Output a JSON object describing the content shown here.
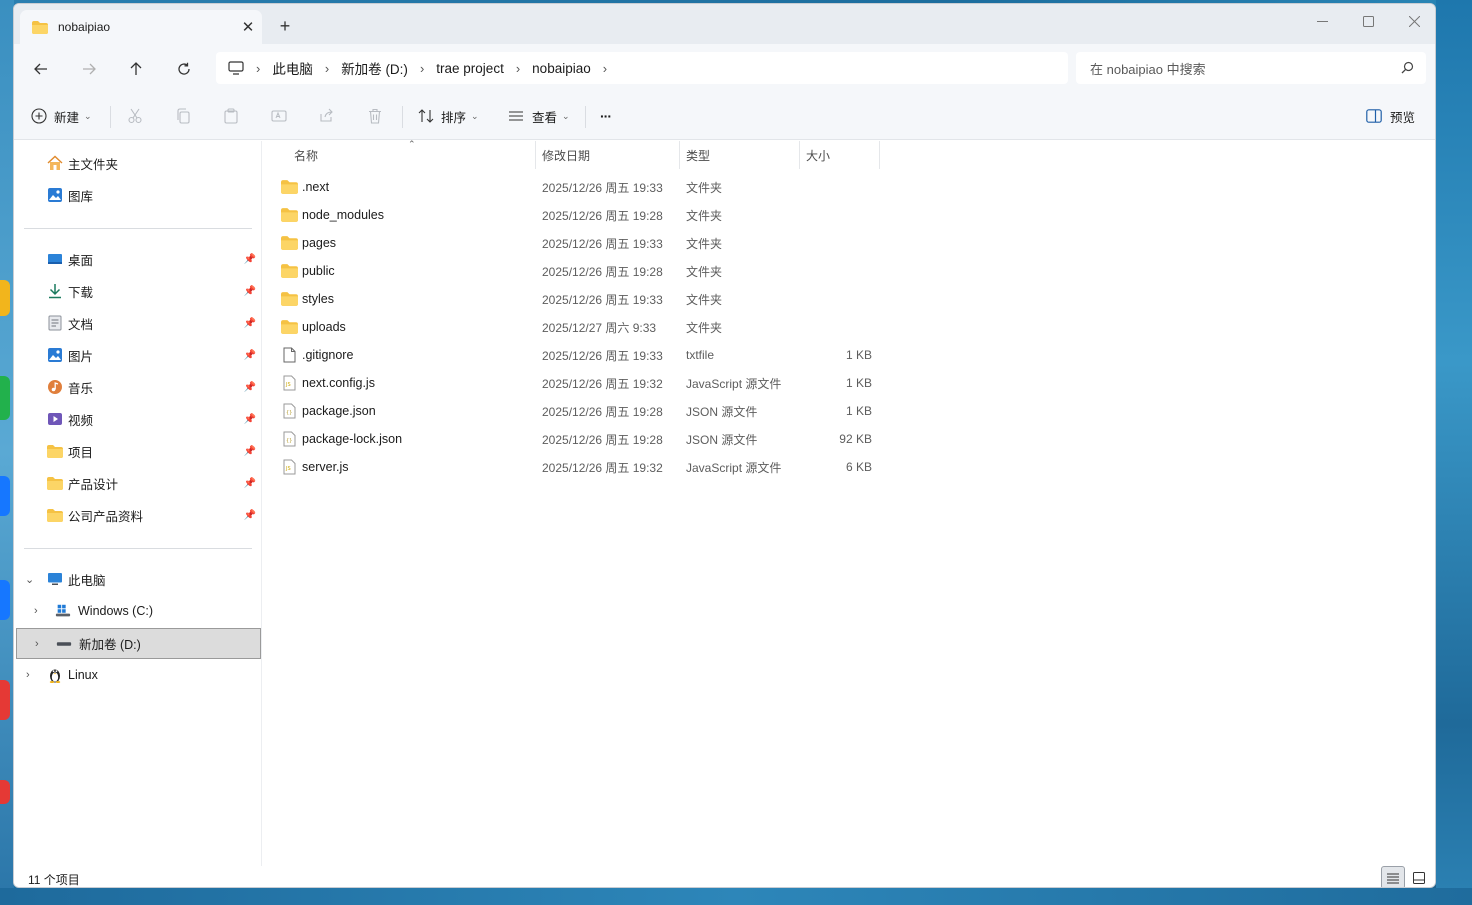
{
  "window": {
    "tab_title": "nobaipiao",
    "new_tab": "+",
    "tab_close": "✕"
  },
  "address": {
    "crumbs": [
      "此电脑",
      "新加卷 (D:)",
      "trae project",
      "nobaipiao"
    ],
    "search_placeholder": "在 nobaipiao 中搜索"
  },
  "toolbar": {
    "new_label": "新建",
    "sort_label": "排序",
    "view_label": "查看",
    "more_label": "···",
    "preview_label": "预览"
  },
  "sidebar": {
    "quick": [
      {
        "label": "主文件夹",
        "icon": "home-icon"
      },
      {
        "label": "图库",
        "icon": "gallery-icon"
      }
    ],
    "pinned": [
      {
        "label": "桌面",
        "icon": "desktop-icon"
      },
      {
        "label": "下载",
        "icon": "download-icon"
      },
      {
        "label": "文档",
        "icon": "document-icon"
      },
      {
        "label": "图片",
        "icon": "pictures-icon"
      },
      {
        "label": "音乐",
        "icon": "music-icon"
      },
      {
        "label": "视频",
        "icon": "video-icon"
      },
      {
        "label": "项目",
        "icon": "folder-icon"
      },
      {
        "label": "产品设计",
        "icon": "folder-icon"
      },
      {
        "label": "公司产品资料",
        "icon": "folder-icon"
      }
    ],
    "pc": {
      "label": "此电脑"
    },
    "drives": [
      {
        "label": "Windows (C:)"
      },
      {
        "label": "新加卷 (D:)"
      }
    ],
    "linux": {
      "label": "Linux"
    }
  },
  "columns": {
    "name": "名称",
    "date": "修改日期",
    "type": "类型",
    "size": "大小"
  },
  "files": [
    {
      "name": ".next",
      "date": "2025/12/26 周五 19:33",
      "type": "文件夹",
      "size": "",
      "kind": "folder"
    },
    {
      "name": "node_modules",
      "date": "2025/12/26 周五 19:28",
      "type": "文件夹",
      "size": "",
      "kind": "folder"
    },
    {
      "name": "pages",
      "date": "2025/12/26 周五 19:33",
      "type": "文件夹",
      "size": "",
      "kind": "folder"
    },
    {
      "name": "public",
      "date": "2025/12/26 周五 19:28",
      "type": "文件夹",
      "size": "",
      "kind": "folder"
    },
    {
      "name": "styles",
      "date": "2025/12/26 周五 19:33",
      "type": "文件夹",
      "size": "",
      "kind": "folder"
    },
    {
      "name": "uploads",
      "date": "2025/12/27 周六 9:33",
      "type": "文件夹",
      "size": "",
      "kind": "folder"
    },
    {
      "name": ".gitignore",
      "date": "2025/12/26 周五 19:33",
      "type": "txtfile",
      "size": "1 KB",
      "kind": "txt"
    },
    {
      "name": "next.config.js",
      "date": "2025/12/26 周五 19:32",
      "type": "JavaScript 源文件",
      "size": "1 KB",
      "kind": "js"
    },
    {
      "name": "package.json",
      "date": "2025/12/26 周五 19:28",
      "type": "JSON 源文件",
      "size": "1 KB",
      "kind": "json"
    },
    {
      "name": "package-lock.json",
      "date": "2025/12/26 周五 19:28",
      "type": "JSON 源文件",
      "size": "92 KB",
      "kind": "json"
    },
    {
      "name": "server.js",
      "date": "2025/12/26 周五 19:32",
      "type": "JavaScript 源文件",
      "size": "6 KB",
      "kind": "js"
    }
  ],
  "status": {
    "count": "11 个项目"
  },
  "colors": {
    "folder": "#f5c244",
    "accent": "#0067c0",
    "selected_bg": "#dcdcdc"
  }
}
